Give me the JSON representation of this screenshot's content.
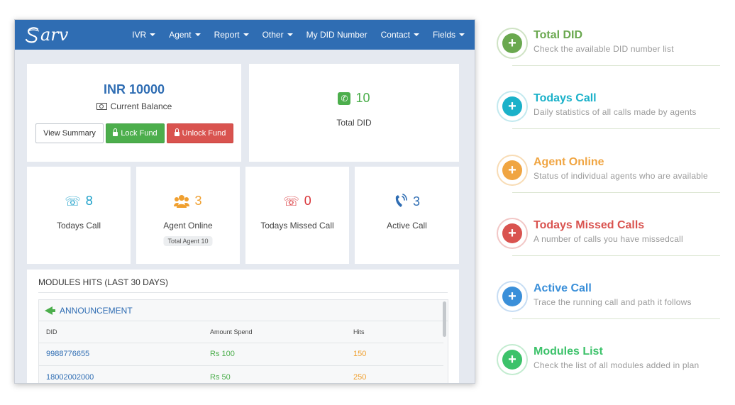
{
  "app": {
    "logo_text": "arv",
    "nav": [
      {
        "label": "IVR",
        "dropdown": true
      },
      {
        "label": "Agent",
        "dropdown": true
      },
      {
        "label": "Report",
        "dropdown": true
      },
      {
        "label": "Other",
        "dropdown": true
      },
      {
        "label": "My DID Number",
        "dropdown": false
      },
      {
        "label": "Contact",
        "dropdown": true
      },
      {
        "label": "Fields",
        "dropdown": true
      }
    ],
    "balance": {
      "amount": "INR 10000",
      "label": "Current Balance",
      "view_summary": "View Summary",
      "lock_fund": "Lock Fund",
      "unlock_fund": "Unlock Fund"
    },
    "total_did": {
      "value": "10",
      "label": "Total DID"
    },
    "stats": {
      "todays_call": {
        "value": "8",
        "label": "Todays Call",
        "color": "#1a9fc9"
      },
      "agent_online": {
        "value": "3",
        "label": "Agent Online",
        "badge": "Total Agent 10",
        "color": "#f0a030"
      },
      "missed_call": {
        "value": "0",
        "label": "Todays Missed Call",
        "color": "#d9363a"
      },
      "active_call": {
        "value": "3",
        "label": "Active Call",
        "color": "#2f6db3"
      }
    },
    "modules": {
      "title": "MODULES HITS (LAST 30 DAYS)",
      "module_name": "ANNOUNCEMENT",
      "columns": [
        "DID",
        "Amount Spend",
        "Hits"
      ],
      "rows": [
        {
          "did": "9988776655",
          "amount": "Rs 100",
          "hits": "150"
        },
        {
          "did": "18002002000",
          "amount": "Rs 50",
          "hits": "250"
        }
      ]
    }
  },
  "features": [
    {
      "title": "Total DID",
      "desc": "Check the available DID number list",
      "color": "#6aa84f"
    },
    {
      "title": "Todays Call",
      "desc": "Daily statistics of all calls made by agents",
      "color": "#1ab1c9"
    },
    {
      "title": "Agent Online",
      "desc": "Status of individual agents who are available",
      "color": "#f0a542"
    },
    {
      "title": "Todays Missed Calls",
      "desc": "A number of calls you have missedcall",
      "color": "#d9534f"
    },
    {
      "title": "Active Call",
      "desc": "Trace the running call and path it follows",
      "color": "#3a8fd9"
    },
    {
      "title": "Modules List",
      "desc": "Check the list of all modules added in plan",
      "color": "#3cc26a"
    }
  ],
  "icons": {
    "plus": "+"
  }
}
